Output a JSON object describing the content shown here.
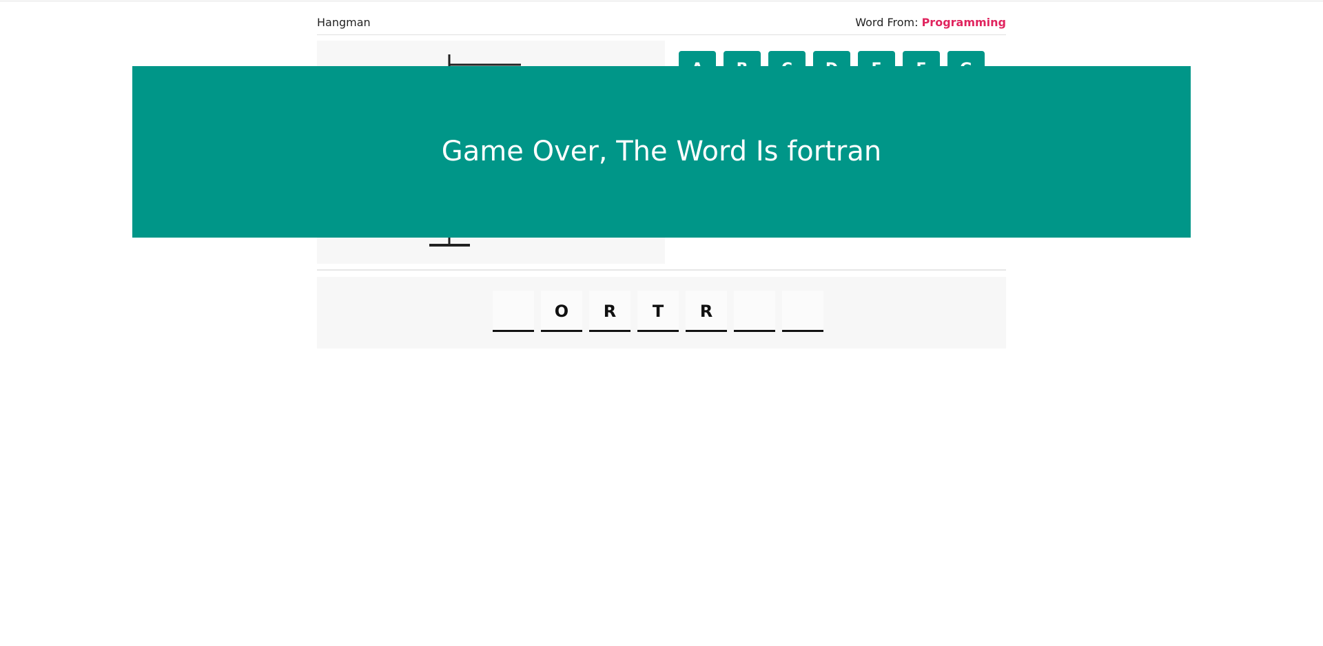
{
  "header": {
    "brand": "Hangman",
    "source_label": "Word From: ",
    "category": "Programming"
  },
  "colors": {
    "accent": "#009688",
    "category": "#e0245e",
    "panel": "#f7f7f7"
  },
  "keyboard": {
    "keys": [
      "A",
      "B",
      "C",
      "D",
      "E",
      "F",
      "G"
    ]
  },
  "word": {
    "slots": [
      "",
      "O",
      "R",
      "T",
      "R",
      "",
      ""
    ]
  },
  "overlay": {
    "message": "Game Over, The Word Is fortran"
  }
}
